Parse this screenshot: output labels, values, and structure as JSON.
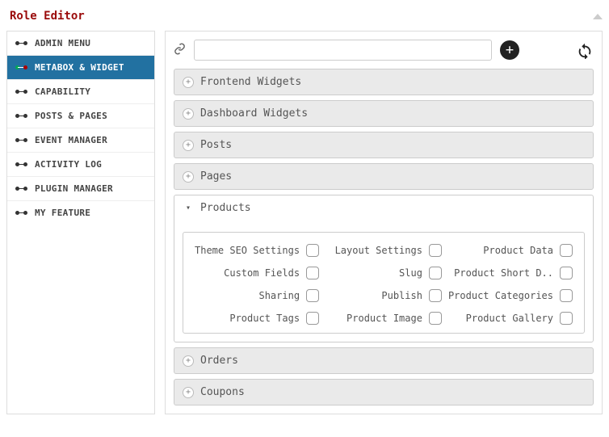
{
  "header": {
    "title": "Role Editor"
  },
  "sidebar": {
    "items": [
      {
        "label": "ADMIN MENU"
      },
      {
        "label": "METABOX & WIDGET"
      },
      {
        "label": "CAPABILITY"
      },
      {
        "label": "POSTS & PAGES"
      },
      {
        "label": "EVENT MANAGER"
      },
      {
        "label": "ACTIVITY LOG"
      },
      {
        "label": "PLUGIN MANAGER"
      },
      {
        "label": "MY FEATURE"
      }
    ]
  },
  "toolbar": {
    "url_value": ""
  },
  "accordion": [
    {
      "label": "Frontend Widgets"
    },
    {
      "label": "Dashboard Widgets"
    },
    {
      "label": "Posts"
    },
    {
      "label": "Pages"
    },
    {
      "label": "Products"
    },
    {
      "label": "Orders"
    },
    {
      "label": "Coupons"
    }
  ],
  "checkboxes": [
    "Theme SEO Settings",
    "Layout Settings",
    "Product Data",
    "Custom Fields",
    "Slug",
    "Product Short D..",
    "Sharing",
    "Publish",
    "Product Categories",
    "Product Tags",
    "Product Image",
    "Product Gallery"
  ]
}
